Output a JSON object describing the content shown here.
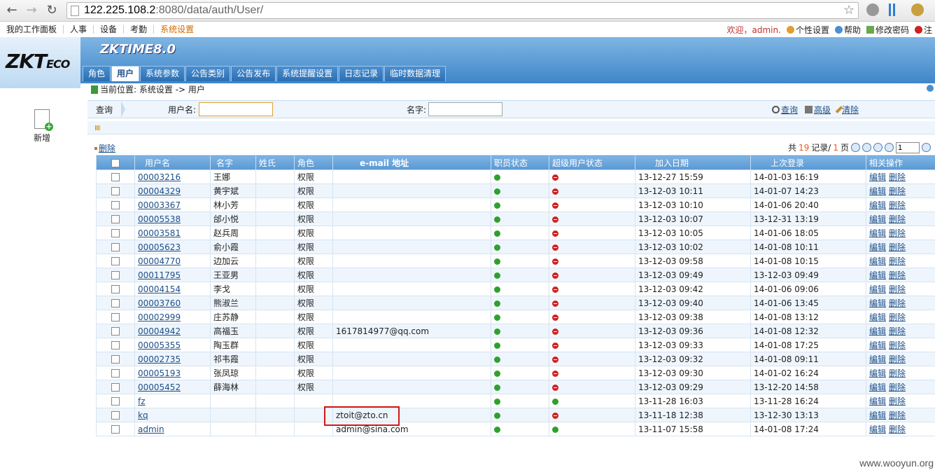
{
  "browser": {
    "url_host": "122.225.108.2",
    "url_rest": ":8080/data/auth/User/"
  },
  "top_menu": {
    "items": [
      "我的工作面板",
      "人事",
      "设备",
      "考勤",
      "系统设置"
    ],
    "welcome": "欢迎，admin.",
    "personal_settings": "个性设置",
    "help": "帮助",
    "change_password": "修改密码",
    "logout": "注"
  },
  "header": {
    "logo_main": "ZKT",
    "logo_sub": "ECO",
    "product": "ZKTIME8.0",
    "tabs": [
      "角色",
      "用户",
      "系统参数",
      "公告类别",
      "公告发布",
      "系统提醒设置",
      "日志记录",
      "临时数据清理"
    ]
  },
  "sidebar": {
    "add_label": "新增"
  },
  "breadcrumb": "当前位置: 系统设置 -> 用户",
  "query": {
    "label": "查询",
    "username_label": "用户名:",
    "name_label": "名字:",
    "search": "查询",
    "advanced": "高级",
    "clear": "清除"
  },
  "actions": {
    "delete": "删除"
  },
  "pager": {
    "total_prefix": "共",
    "total": "19",
    "records_label": "记录/",
    "pages": "1",
    "pages_label": "页",
    "current_page": "1"
  },
  "table": {
    "headers": [
      "用户名",
      "名字",
      "姓氏",
      "角色",
      "e-mail 地址",
      "职员状态",
      "超级用户状态",
      "加入日期",
      "上次登录",
      "相关操作"
    ],
    "op_edit": "编辑",
    "op_delete": "删除",
    "rows": [
      {
        "username": "00003216",
        "name": "王娜",
        "surname": "",
        "role": "权限",
        "email": "",
        "staff": "ok",
        "super": "no",
        "joined": "13-12-27 15:59",
        "last": "14-01-03 16:19"
      },
      {
        "username": "00004329",
        "name": "黄宇斌",
        "surname": "",
        "role": "权限",
        "email": "",
        "staff": "ok",
        "super": "no",
        "joined": "13-12-03 10:11",
        "last": "14-01-07 14:23"
      },
      {
        "username": "00003367",
        "name": "林小芳",
        "surname": "",
        "role": "权限",
        "email": "",
        "staff": "ok",
        "super": "no",
        "joined": "13-12-03 10:10",
        "last": "14-01-06 20:40"
      },
      {
        "username": "00005538",
        "name": "邰小悦",
        "surname": "",
        "role": "权限",
        "email": "",
        "staff": "ok",
        "super": "no",
        "joined": "13-12-03 10:07",
        "last": "13-12-31 13:19"
      },
      {
        "username": "00003581",
        "name": "赵兵周",
        "surname": "",
        "role": "权限",
        "email": "",
        "staff": "ok",
        "super": "no",
        "joined": "13-12-03 10:05",
        "last": "14-01-06 18:05"
      },
      {
        "username": "00005623",
        "name": "俞小霞",
        "surname": "",
        "role": "权限",
        "email": "",
        "staff": "ok",
        "super": "no",
        "joined": "13-12-03 10:02",
        "last": "14-01-08 10:11"
      },
      {
        "username": "00004770",
        "name": "边加云",
        "surname": "",
        "role": "权限",
        "email": "",
        "staff": "ok",
        "super": "no",
        "joined": "13-12-03 09:58",
        "last": "14-01-08 10:15"
      },
      {
        "username": "00011795",
        "name": "王亚男",
        "surname": "",
        "role": "权限",
        "email": "",
        "staff": "ok",
        "super": "no",
        "joined": "13-12-03 09:49",
        "last": "13-12-03 09:49"
      },
      {
        "username": "00004154",
        "name": "李戈",
        "surname": "",
        "role": "权限",
        "email": "",
        "staff": "ok",
        "super": "no",
        "joined": "13-12-03 09:42",
        "last": "14-01-06 09:06"
      },
      {
        "username": "00003760",
        "name": "熊淑兰",
        "surname": "",
        "role": "权限",
        "email": "",
        "staff": "ok",
        "super": "no",
        "joined": "13-12-03 09:40",
        "last": "14-01-06 13:45"
      },
      {
        "username": "00002999",
        "name": "庄苏静",
        "surname": "",
        "role": "权限",
        "email": "",
        "staff": "ok",
        "super": "no",
        "joined": "13-12-03 09:38",
        "last": "14-01-08 13:12"
      },
      {
        "username": "00004942",
        "name": "高福玉",
        "surname": "",
        "role": "权限",
        "email": "1617814977@qq.com",
        "staff": "ok",
        "super": "no",
        "joined": "13-12-03 09:36",
        "last": "14-01-08 12:32"
      },
      {
        "username": "00005355",
        "name": "陶玉群",
        "surname": "",
        "role": "权限",
        "email": "",
        "staff": "ok",
        "super": "no",
        "joined": "13-12-03 09:33",
        "last": "14-01-08 17:25"
      },
      {
        "username": "00002735",
        "name": "祁韦霞",
        "surname": "",
        "role": "权限",
        "email": "",
        "staff": "ok",
        "super": "no",
        "joined": "13-12-03 09:32",
        "last": "14-01-08 09:11"
      },
      {
        "username": "00005193",
        "name": "张凤琼",
        "surname": "",
        "role": "权限",
        "email": "",
        "staff": "ok",
        "super": "no",
        "joined": "13-12-03 09:30",
        "last": "14-01-02 16:24"
      },
      {
        "username": "00005452",
        "name": "薛海林",
        "surname": "",
        "role": "权限",
        "email": "",
        "staff": "ok",
        "super": "no",
        "joined": "13-12-03 09:29",
        "last": "13-12-20 14:58"
      },
      {
        "username": "fz",
        "name": "",
        "surname": "",
        "role": "",
        "email": "",
        "staff": "ok",
        "super": "ok",
        "joined": "13-11-28 16:03",
        "last": "13-11-28 16:24"
      },
      {
        "username": "kq",
        "name": "",
        "surname": "",
        "role": "",
        "email": "ztoit@zto.cn",
        "staff": "ok",
        "super": "no",
        "joined": "13-11-18 12:38",
        "last": "13-12-30 13:13"
      },
      {
        "username": "admin",
        "name": "",
        "surname": "",
        "role": "",
        "email": "admin@sina.com",
        "staff": "ok",
        "super": "ok",
        "joined": "13-11-07 15:58",
        "last": "14-01-08 17:24"
      }
    ]
  },
  "watermark": "www.wooyun.org"
}
